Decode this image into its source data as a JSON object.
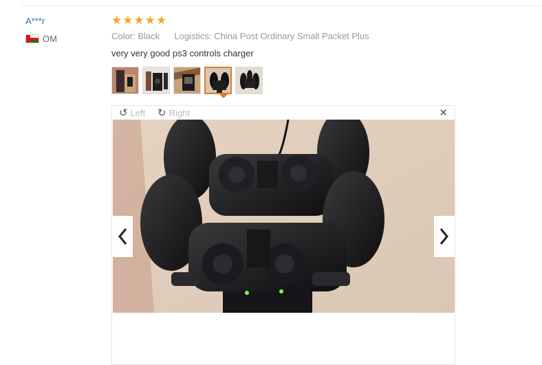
{
  "review": {
    "user": "A***r",
    "country_code": "OM",
    "rating": 5,
    "color_label": "Color:",
    "color_value": "Black",
    "logistics_label": "Logistics:",
    "logistics_value": "China Post Ordinary Small Packet Plus",
    "comment": "very very good ps3 controls charger",
    "thumbnail_count": 5,
    "active_thumbnail": 4
  },
  "viewer": {
    "rotate_left_label": "Left",
    "rotate_right_label": "Right",
    "close_icon": "close-icon",
    "prev_icon": "chevron-left-icon",
    "next_icon": "chevron-right-icon"
  },
  "colors": {
    "username": "#2a6bb5",
    "star": "#f5a623",
    "active_border": "#e07b2a"
  }
}
